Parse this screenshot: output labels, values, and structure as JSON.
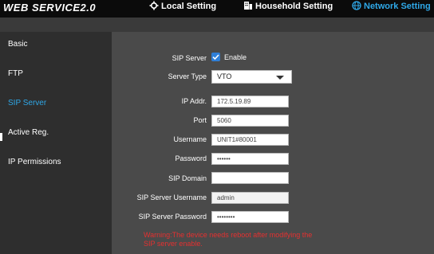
{
  "brand": "WEB SERVICE2.0",
  "nav": {
    "local": "Local Setting",
    "household": "Household Setting",
    "network": "Network Setting"
  },
  "sidebar": {
    "items": [
      {
        "label": "Basic"
      },
      {
        "label": "FTP"
      },
      {
        "label": "SIP Server"
      },
      {
        "label": "Active Reg."
      },
      {
        "label": "IP Permissions"
      }
    ],
    "active_index": 2
  },
  "form": {
    "sip_server_label": "SIP Server",
    "enable_label": "Enable",
    "enable_checked": true,
    "server_type_label": "Server Type",
    "server_type_value": "VTO",
    "ip_label": "IP Addr.",
    "ip_value": "172.5.19.89",
    "port_label": "Port",
    "port_value": "5060",
    "username_label": "Username",
    "username_value": "UNIT1#80001",
    "password_label": "Password",
    "password_value": "••••••",
    "domain_label": "SIP Domain",
    "domain_value": "",
    "sip_username_label": "SIP Server Username",
    "sip_username_value": "admin",
    "sip_password_label": "SIP Server Password",
    "sip_password_value": "••••••••"
  },
  "warning": "Warning:The device needs reboot after modifying the SIP server enable.",
  "colors": {
    "accent": "#2fa8e8",
    "warning": "#e53030",
    "checkbox": "#2f7fd8"
  }
}
